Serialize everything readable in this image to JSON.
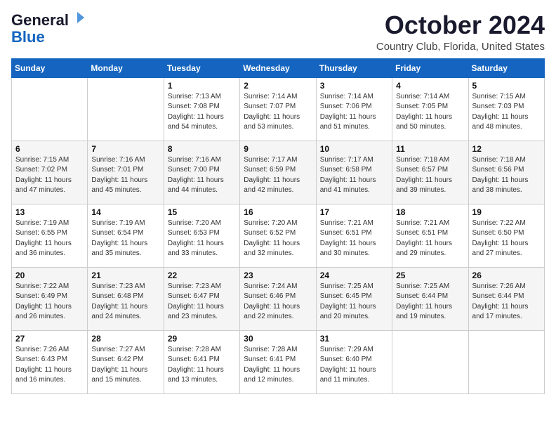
{
  "logo": {
    "general": "General",
    "blue": "Blue",
    "flag_color1": "#1565c0",
    "flag_color2": "#90caf9"
  },
  "header": {
    "month": "October 2024",
    "location": "Country Club, Florida, United States"
  },
  "weekdays": [
    "Sunday",
    "Monday",
    "Tuesday",
    "Wednesday",
    "Thursday",
    "Friday",
    "Saturday"
  ],
  "weeks": [
    [
      {
        "day": "",
        "info": ""
      },
      {
        "day": "",
        "info": ""
      },
      {
        "day": "1",
        "info": "Sunrise: 7:13 AM\nSunset: 7:08 PM\nDaylight: 11 hours and 54 minutes."
      },
      {
        "day": "2",
        "info": "Sunrise: 7:14 AM\nSunset: 7:07 PM\nDaylight: 11 hours and 53 minutes."
      },
      {
        "day": "3",
        "info": "Sunrise: 7:14 AM\nSunset: 7:06 PM\nDaylight: 11 hours and 51 minutes."
      },
      {
        "day": "4",
        "info": "Sunrise: 7:14 AM\nSunset: 7:05 PM\nDaylight: 11 hours and 50 minutes."
      },
      {
        "day": "5",
        "info": "Sunrise: 7:15 AM\nSunset: 7:03 PM\nDaylight: 11 hours and 48 minutes."
      }
    ],
    [
      {
        "day": "6",
        "info": "Sunrise: 7:15 AM\nSunset: 7:02 PM\nDaylight: 11 hours and 47 minutes."
      },
      {
        "day": "7",
        "info": "Sunrise: 7:16 AM\nSunset: 7:01 PM\nDaylight: 11 hours and 45 minutes."
      },
      {
        "day": "8",
        "info": "Sunrise: 7:16 AM\nSunset: 7:00 PM\nDaylight: 11 hours and 44 minutes."
      },
      {
        "day": "9",
        "info": "Sunrise: 7:17 AM\nSunset: 6:59 PM\nDaylight: 11 hours and 42 minutes."
      },
      {
        "day": "10",
        "info": "Sunrise: 7:17 AM\nSunset: 6:58 PM\nDaylight: 11 hours and 41 minutes."
      },
      {
        "day": "11",
        "info": "Sunrise: 7:18 AM\nSunset: 6:57 PM\nDaylight: 11 hours and 39 minutes."
      },
      {
        "day": "12",
        "info": "Sunrise: 7:18 AM\nSunset: 6:56 PM\nDaylight: 11 hours and 38 minutes."
      }
    ],
    [
      {
        "day": "13",
        "info": "Sunrise: 7:19 AM\nSunset: 6:55 PM\nDaylight: 11 hours and 36 minutes."
      },
      {
        "day": "14",
        "info": "Sunrise: 7:19 AM\nSunset: 6:54 PM\nDaylight: 11 hours and 35 minutes."
      },
      {
        "day": "15",
        "info": "Sunrise: 7:20 AM\nSunset: 6:53 PM\nDaylight: 11 hours and 33 minutes."
      },
      {
        "day": "16",
        "info": "Sunrise: 7:20 AM\nSunset: 6:52 PM\nDaylight: 11 hours and 32 minutes."
      },
      {
        "day": "17",
        "info": "Sunrise: 7:21 AM\nSunset: 6:51 PM\nDaylight: 11 hours and 30 minutes."
      },
      {
        "day": "18",
        "info": "Sunrise: 7:21 AM\nSunset: 6:51 PM\nDaylight: 11 hours and 29 minutes."
      },
      {
        "day": "19",
        "info": "Sunrise: 7:22 AM\nSunset: 6:50 PM\nDaylight: 11 hours and 27 minutes."
      }
    ],
    [
      {
        "day": "20",
        "info": "Sunrise: 7:22 AM\nSunset: 6:49 PM\nDaylight: 11 hours and 26 minutes."
      },
      {
        "day": "21",
        "info": "Sunrise: 7:23 AM\nSunset: 6:48 PM\nDaylight: 11 hours and 24 minutes."
      },
      {
        "day": "22",
        "info": "Sunrise: 7:23 AM\nSunset: 6:47 PM\nDaylight: 11 hours and 23 minutes."
      },
      {
        "day": "23",
        "info": "Sunrise: 7:24 AM\nSunset: 6:46 PM\nDaylight: 11 hours and 22 minutes."
      },
      {
        "day": "24",
        "info": "Sunrise: 7:25 AM\nSunset: 6:45 PM\nDaylight: 11 hours and 20 minutes."
      },
      {
        "day": "25",
        "info": "Sunrise: 7:25 AM\nSunset: 6:44 PM\nDaylight: 11 hours and 19 minutes."
      },
      {
        "day": "26",
        "info": "Sunrise: 7:26 AM\nSunset: 6:44 PM\nDaylight: 11 hours and 17 minutes."
      }
    ],
    [
      {
        "day": "27",
        "info": "Sunrise: 7:26 AM\nSunset: 6:43 PM\nDaylight: 11 hours and 16 minutes."
      },
      {
        "day": "28",
        "info": "Sunrise: 7:27 AM\nSunset: 6:42 PM\nDaylight: 11 hours and 15 minutes."
      },
      {
        "day": "29",
        "info": "Sunrise: 7:28 AM\nSunset: 6:41 PM\nDaylight: 11 hours and 13 minutes."
      },
      {
        "day": "30",
        "info": "Sunrise: 7:28 AM\nSunset: 6:41 PM\nDaylight: 11 hours and 12 minutes."
      },
      {
        "day": "31",
        "info": "Sunrise: 7:29 AM\nSunset: 6:40 PM\nDaylight: 11 hours and 11 minutes."
      },
      {
        "day": "",
        "info": ""
      },
      {
        "day": "",
        "info": ""
      }
    ]
  ]
}
